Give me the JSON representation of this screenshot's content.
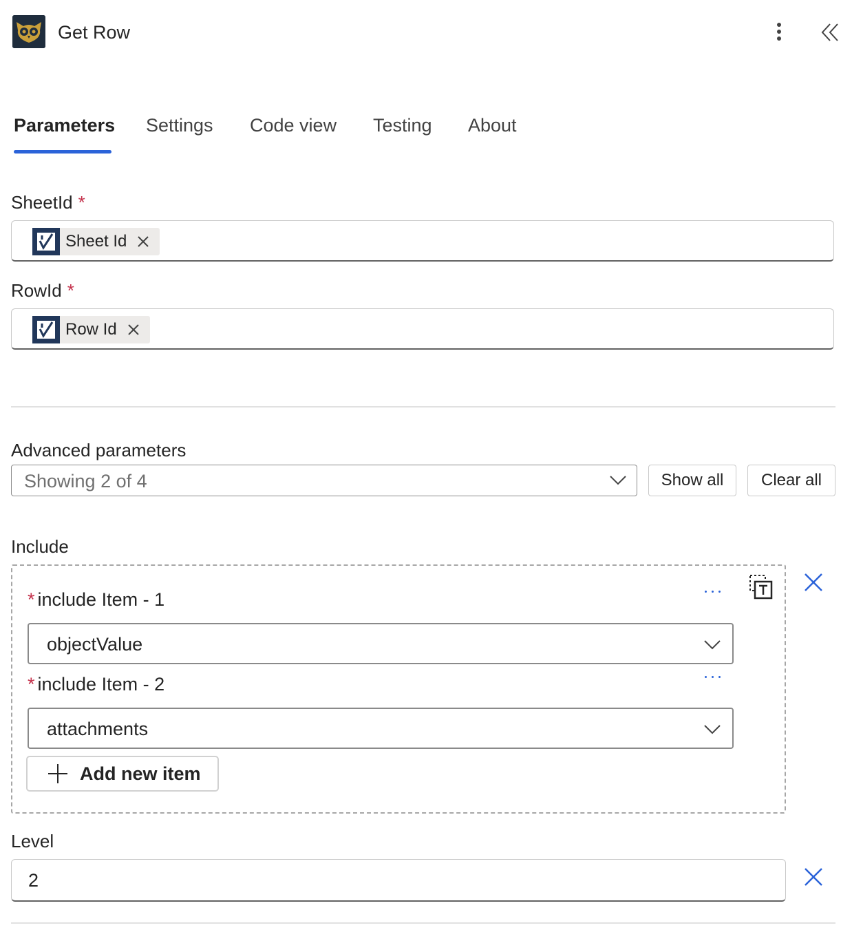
{
  "header": {
    "title": "Get Row",
    "logo_icon": "owl-logo-icon",
    "more_icon": "more-vertical-icon",
    "collapse_icon": "double-chevron-left-icon"
  },
  "tabs": [
    {
      "label": "Parameters",
      "active": true
    },
    {
      "label": "Settings",
      "active": false
    },
    {
      "label": "Code view",
      "active": false
    },
    {
      "label": "Testing",
      "active": false
    },
    {
      "label": "About",
      "active": false
    }
  ],
  "colors": {
    "accent": "#2b63d9",
    "required": "#c4314b",
    "token_icon_bg": "#21375a"
  },
  "parameters": {
    "sheet_id": {
      "label": "SheetId",
      "required_mark": "*",
      "token_label": "Sheet Id"
    },
    "row_id": {
      "label": "RowId",
      "required_mark": "*",
      "token_label": "Row Id"
    }
  },
  "advanced": {
    "label": "Advanced parameters",
    "dropdown_value": "Showing 2 of 4",
    "show_all_label": "Show all",
    "clear_all_label": "Clear all"
  },
  "include": {
    "label": "Include",
    "items": [
      {
        "required_mark": "*",
        "label": "include Item - 1",
        "value": "objectValue"
      },
      {
        "required_mark": "*",
        "label": "include Item - 2",
        "value": "attachments"
      }
    ],
    "add_label": "Add new item"
  },
  "level": {
    "label": "Level",
    "value": "2"
  }
}
